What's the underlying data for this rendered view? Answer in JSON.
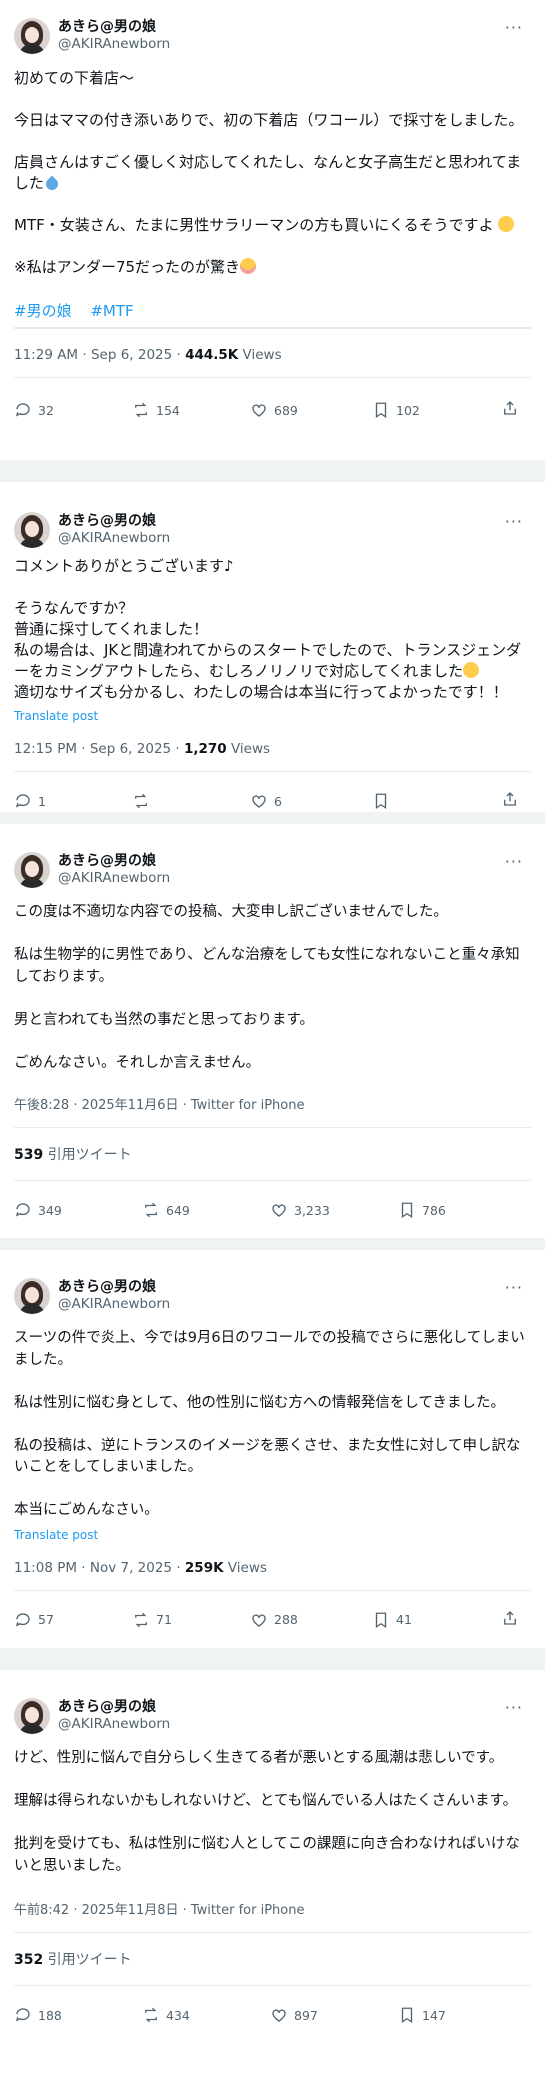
{
  "user": {
    "display_name": "あきら@男の娘",
    "handle": "@AKIRAnewborn"
  },
  "more_label": "···",
  "tweets": [
    {
      "text": "初めての下着店〜\n\n今日はママの付き添いありで、初の下着店（ワコール）で採寸をしました。\n\n店員さんはすごく優しく対応してくれたし、なんと女子高生だと思われてました",
      "text2": "\n\nMTF・女装さん、たまに男性サラリーマンの方も買いにくるそうですよ",
      "text3": "\n\n※私はアンダー75だったのが驚き",
      "hashtags": [
        "#男の娘",
        "#MTF"
      ],
      "time": "11:29 AM · Sep 6, 2025 · ",
      "views": "444.5K",
      "views_label": " Views",
      "replies": "32",
      "reposts": "154",
      "likes": "689",
      "bookmarks": "102"
    },
    {
      "text": "コメントありがとうございます♪\n\nそうなんですか？\n普通に採寸してくれました！\n私の場合は、JKと間違われてからのスタートでしたので、トランスジェンダーをカミングアウトしたら、むしろノリノリで対応してくれました",
      "text2": "\n適切なサイズも分かるし、わたしの場合は本当に行ってよかったです！！",
      "translate": "Translate post",
      "time": "12:15 PM · Sep 6, 2025 · ",
      "views": "1,270",
      "views_label": " Views",
      "replies": "1",
      "reposts": "",
      "likes": "6",
      "bookmarks": ""
    },
    {
      "text": "この度は不適切な内容での投稿、大変申し訳ございませんでした。\n\n私は生物学的に男性であり、どんな治療をしても女性になれないこと重々承知しております。\n\n男と言われても当然の事だと思っております。\n\nごめんなさい。それしか言えません。",
      "time": "午後8:28 · 2025年11月6日 · Twitter for iPhone",
      "quotes": "539",
      "quotes_label": " 引用ツイート",
      "replies": "349",
      "reposts": "649",
      "likes": "3,233",
      "bookmarks": "786"
    },
    {
      "text": "スーツの件で炎上、今では9月6日のワコールでの投稿でさらに悪化してしまいました。\n\n私は性別に悩む身として、他の性別に悩む方への情報発信をしてきました。\n\n私の投稿は、逆にトランスのイメージを悪くさせ、また女性に対して申し訳ないことをしてしまいました。\n\n本当にごめんなさい。",
      "translate": "Translate post",
      "time": "11:08 PM · Nov 7, 2025 · ",
      "views": "259K",
      "views_label": " Views",
      "replies": "57",
      "reposts": "71",
      "likes": "288",
      "bookmarks": "41"
    },
    {
      "text": "けど、性別に悩んで自分らしく生きてる者が悪いとする風潮は悲しいです。\n\n理解は得られないかもしれないけど、とても悩んでいる人はたくさんいます。\n\n批判を受けても、私は性別に悩む人としてこの課題に向き合わなければいけないと思いました。",
      "time": "午前8:42 · 2025年11月8日 · Twitter for iPhone",
      "quotes": "352",
      "quotes_label": " 引用ツイート",
      "replies": "188",
      "reposts": "434",
      "likes": "897",
      "bookmarks": "147"
    }
  ]
}
